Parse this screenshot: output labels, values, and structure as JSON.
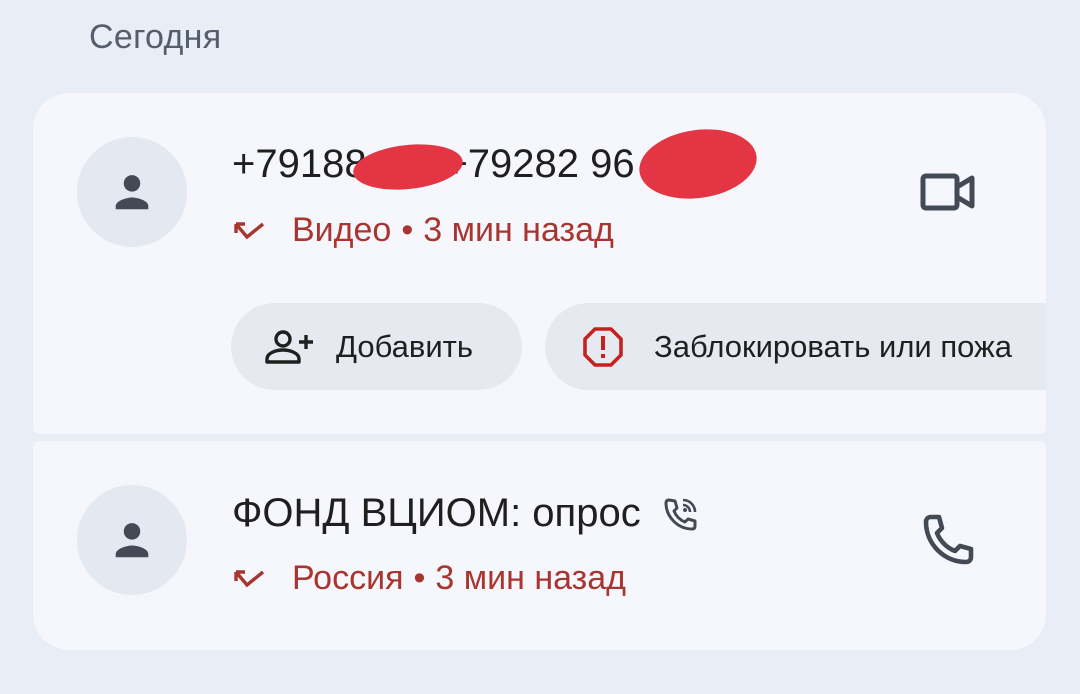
{
  "section": {
    "title": "Сегодня"
  },
  "calls": [
    {
      "name": "+79188    944+79282     96",
      "type_label": "Видео",
      "separator": "•",
      "time": "3 мин назад",
      "action_icon": "video-icon"
    },
    {
      "name": "ФОНД ВЦИОМ: опрос",
      "type_label": "Россия",
      "separator": "•",
      "time": "3 мин назад",
      "action_icon": "phone-icon"
    }
  ],
  "actions": {
    "add_label": "Добавить",
    "block_label": "Заблокировать или пожа"
  },
  "colors": {
    "background": "#e9edf5",
    "card": "#f6f7fc",
    "missed": "#a8352f",
    "chip": "#e6e9f0",
    "redaction": "#e33544"
  }
}
